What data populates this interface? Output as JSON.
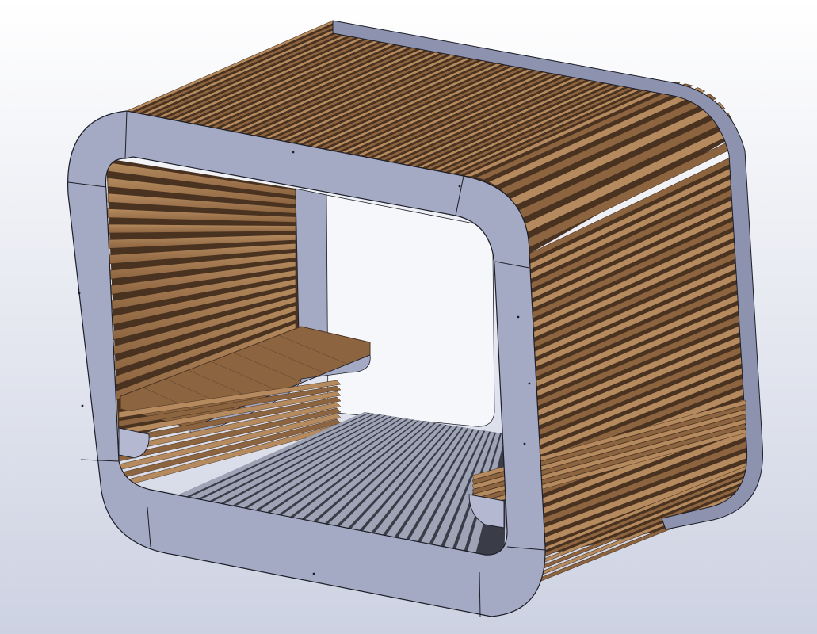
{
  "viewport": {
    "background_top": "#ffffff",
    "background_bottom": "#cdd2e2"
  },
  "colors": {
    "frame_face": "#a5aac4",
    "frame_edge": "#1c1e28",
    "frame_shade": "#8d92ae",
    "frame_light": "#b4b8d0",
    "wood_light": "#b48a5e",
    "wood_mid": "#8c6440",
    "wood_dark": "#4a3220",
    "floor_slat": "#9ea3b5",
    "floor_gap": "#3a3d48",
    "outline": "#000000"
  },
  "model": {
    "name": "slatted cabin",
    "seats": 2,
    "shelves": 1
  }
}
